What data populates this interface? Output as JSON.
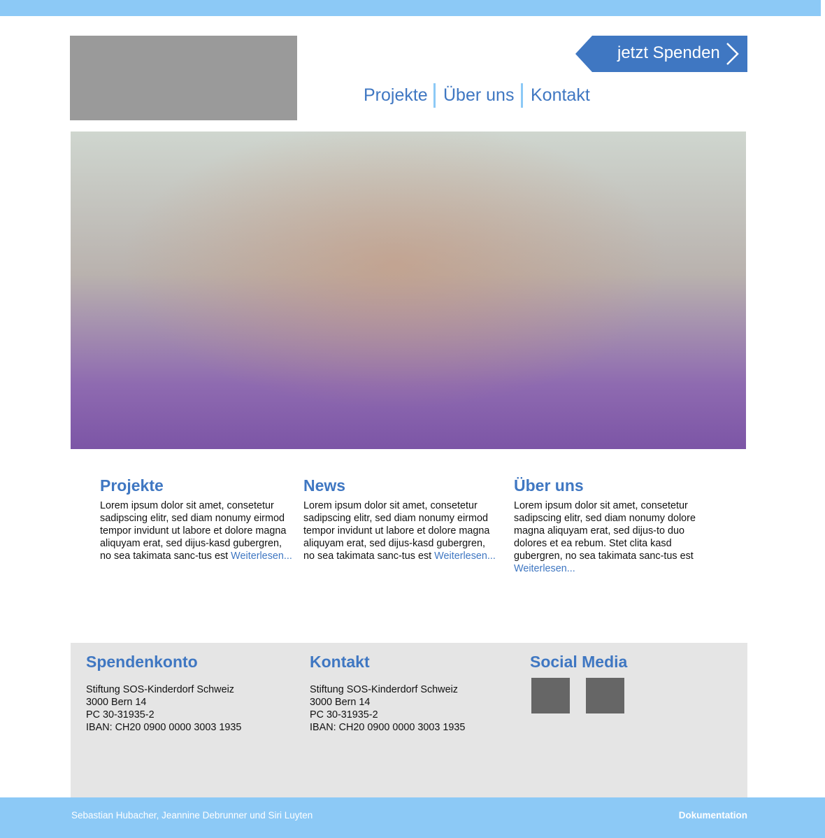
{
  "header": {
    "logo": "",
    "donate_label": "jetzt Spenden",
    "nav": [
      "Projekte",
      "Über uns",
      "Kontakt"
    ]
  },
  "hero": {
    "image_alt": ""
  },
  "columns": [
    {
      "title": "Projekte",
      "text": "Lorem ipsum dolor sit amet, consetetur sadipscing elitr, sed diam nonumy eirmod tempor invidunt ut labore et dolore magna aliquyam erat, sed dijus-kasd gubergren, no sea takimata sanc-tus est",
      "link": "Weiterlesen..."
    },
    {
      "title": "News",
      "text": "Lorem ipsum dolor sit amet, consetetur sadipscing elitr, sed diam nonumy eirmod tempor invidunt ut labore et dolore magna aliquyam erat, sed dijus-kasd gubergren, no sea takimata sanc-tus est",
      "link": "Weiterlesen..."
    },
    {
      "title": "Über uns",
      "text": "Lorem ipsum dolor sit amet, consetetur sadipscing elitr, sed diam nonumy dolore magna aliquyam erat, sed dijus-to duo dolores et ea rebum. Stet clita kasd gubergren, no sea takimata sanc-tus est",
      "link": "Weiterlesen..."
    }
  ],
  "footer": {
    "spendenkonto": {
      "title": "Spendenkonto",
      "lines": [
        "Stiftung SOS-Kinderdorf Schweiz",
        "3000 Bern 14",
        "PC 30-31935-2",
        "IBAN: CH20 0900 0000 3003 1935"
      ]
    },
    "kontakt": {
      "title": "Kontakt",
      "lines": [
        "Stiftung SOS-Kinderdorf Schweiz",
        "3000 Bern 14",
        "PC 30-31935-2",
        "IBAN: CH20 0900 0000 3003 1935"
      ]
    },
    "social": {
      "title": "Social Media",
      "icons": [
        "social-icon-1",
        "social-icon-2"
      ]
    }
  },
  "bottom": {
    "authors": "Sebastian Hubacher, Jeannine Debrunner und Siri Luyten",
    "documentation": "Dokumentation"
  },
  "colors": {
    "accent": "#3f77c2",
    "bar": "#8cc9f6",
    "footer_bg": "#e5e5e5",
    "placeholder": "#9a9a9a"
  }
}
